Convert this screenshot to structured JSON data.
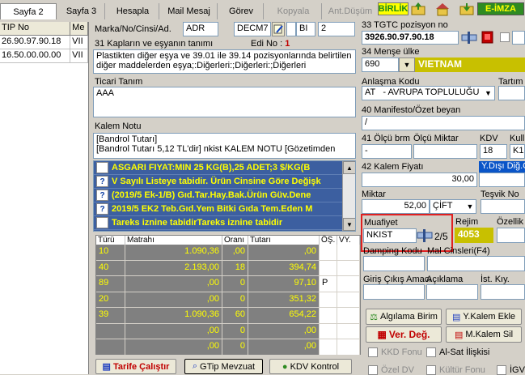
{
  "tabs": [
    "Sayfa 2",
    "Sayfa 3",
    "Hesapla",
    "Mail Mesaj",
    "Görev",
    "Kopyala",
    "Ant.Düşüm"
  ],
  "toolbar": {
    "birlik": "BİRLİK",
    "eimza": "E-İMZA"
  },
  "left_grid": {
    "headers": [
      "TIP No",
      "Me"
    ],
    "rows": [
      [
        "26.90.97.90.18",
        "VII"
      ],
      [
        "16.50.00.00.00",
        "VII"
      ]
    ]
  },
  "form": {
    "marka_label": "Marka/No/Cinsi/Ad.",
    "marka_val1": "ADR",
    "marka_val2": "DECM7",
    "marka_val3": "BI",
    "marka_val4": "2",
    "kap_label": "31 Kapların ve eşyanın tanımı",
    "edi_label": "Edi No :",
    "edi_value": "1",
    "kap_text": "Plastikten diğer eşya ve 39.01 ile 39.14 pozisyonlarında belirtilen diğer maddelerden eşya;:Diğerleri:;Diğerleri:;Diğerleri",
    "ticari_label": "Ticari Tanım",
    "ticari_value": "AAA",
    "kalem_notu_label": "Kalem Notu",
    "kalem_notu_lines": [
      "[Bandrol Tutarı]",
      "[Bandrol Tutarı 5,12 TL'dir] nkist KALEM NOTU  [Gözetimden"
    ]
  },
  "notes": [
    {
      "mark": "",
      "text": "ASGARI FIYAT:MIN 25 KG(B),25 ADET;3 $/KG(B"
    },
    {
      "mark": "?",
      "text": "V Sayılı Listeye tabidir. Ürün Cinsine Göre Değişk"
    },
    {
      "mark": "?",
      "text": "(2019/5 Ek-1/B) Gıd.Tar.Hay.Bak.Ürün Güv.Dene"
    },
    {
      "mark": "?",
      "text": "2019/5 EK2 Teb.Gıd.Yem Bitki Gıda Tem.Eden M"
    },
    {
      "mark": "",
      "text": "Tareks iznine tabidirTareks iznine tabidir"
    }
  ],
  "tax_grid": {
    "headers": [
      "Türü",
      "Matrahı",
      "Oranı",
      "Tutarı",
      "ÖŞ.",
      "VY."
    ],
    "rows": [
      [
        "10",
        "1.090,36",
        ",00",
        ",00",
        "",
        ""
      ],
      [
        "40",
        "2.193,00",
        "18",
        "394,74",
        "",
        ""
      ],
      [
        "89",
        ",00",
        "0",
        "97,10",
        "P",
        ""
      ],
      [
        "20",
        ",00",
        "0",
        "351,32",
        "",
        ""
      ],
      [
        "39",
        "1.090,36",
        "60",
        "654,22",
        "",
        ""
      ],
      [
        "",
        ",00",
        "0",
        ",00",
        "",
        ""
      ],
      [
        "",
        ",00",
        "0",
        ",00",
        "",
        ""
      ]
    ]
  },
  "bottom_buttons": {
    "tarife": "Tarife Çalıştır",
    "gtip": "GTip Mevzuat",
    "kdv": "KDV Kontrol"
  },
  "right": {
    "tgtc_label": "33 TGTC pozisyon no",
    "tgtc_value": "3926.90.97.90.18",
    "mense_label": "34 Menşe ülke",
    "mense_code": "690",
    "mense_name": "VIETNAM",
    "anlasma_label": "Anlaşma Kodu",
    "anlasma_code": "AT",
    "anlasma_name": "- AVRUPA TOPLULUĞU",
    "tartim_label": "Tartım",
    "manifesto_label": "40 Manifesto/Özet beyan",
    "manifesto_value": "/",
    "olcu_label": "41 Ölçü brm",
    "olcu_miktar_label": "Ölçü Miktar",
    "kdv_label": "KDV",
    "kull_label": "Kull",
    "olcu_value": "-",
    "kdv_value": "18",
    "kull_value": "K1",
    "kalem_fiyati_label": "42 Kalem Fiyatı",
    "kalem_fiyati_value": "30,00",
    "ydisi_label": "Y.Dışı Diğ.G",
    "miktar_label": "Miktar",
    "miktar_value": "52,00",
    "miktar_unit": "ÇİFT",
    "tesvik_label": "Teşvik No",
    "muafiyet_label": "Muafiyet",
    "muafiyet_value": "NKIST",
    "muafiyet_page": "2/5",
    "rejim_label": "Rejim",
    "rejim_value": "4053",
    "ozellik_label": "Özellik",
    "damping_label": "Damping Kodu",
    "mal_cinsleri_label": "Mal Cinsleri(F4)",
    "giris_label": "Giriş Çıkış Amacı",
    "aciklama_label": "Açıklama",
    "ist_label": "İst. Kıy.",
    "algilama_btn": "Algılama Birim",
    "ykalem_btn": "Y.Kalem Ekle",
    "verdeg_btn": "Ver. Değ.",
    "mkalemsil_btn": "M.Kalem Sil",
    "kkd_label": "KKD Fonu",
    "alsat_label": "Al-Sat İlişkisi",
    "ozel_label": "Özel DV",
    "kultur_label": "Kültür Fonu",
    "igv_label": "İGV"
  },
  "colors": {
    "highlight_red": "#e02020",
    "yellow_text": "#ffff00",
    "note_bg": "#3c5fa0",
    "green": "#2e8b22"
  }
}
